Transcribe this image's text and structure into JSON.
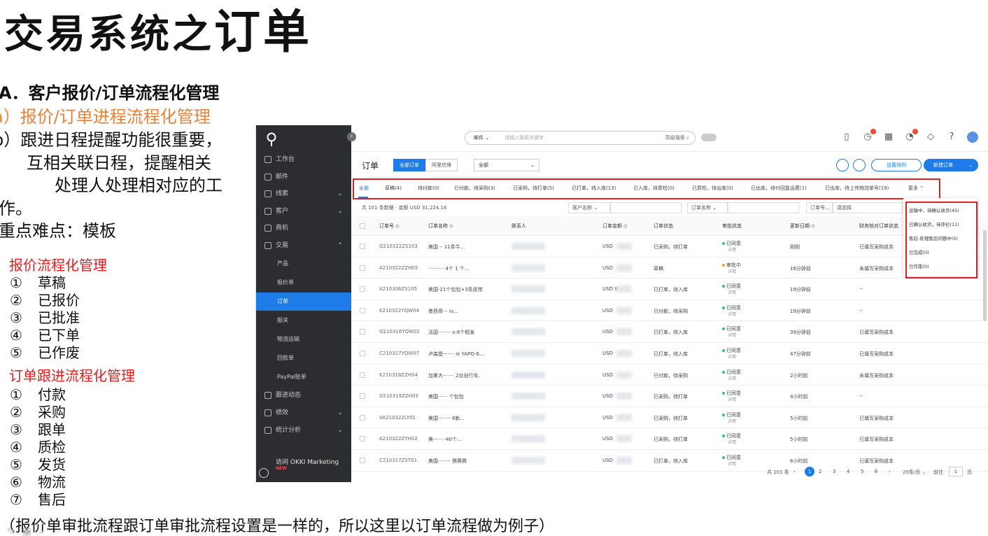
{
  "slide": {
    "title_part1": "交易系统之",
    "title_part2": "订单",
    "heading_a": "A．客户报价/订单流程化管理",
    "line_a": "a）报价/订单进程流程化管理",
    "line_b1": "b）跟进日程提醒功能很重要，",
    "line_b2": "互相关联日程，提醒相关",
    "line_b3": "处理人处理相对应的工",
    "line_b4": "作。",
    "line_key": "重点难点：模板",
    "quote_flow_title": "报价流程化管理",
    "quote_flow": [
      {
        "num": "①",
        "label": "草稿"
      },
      {
        "num": "②",
        "label": "已报价"
      },
      {
        "num": "③",
        "label": "已批准"
      },
      {
        "num": "④",
        "label": "已下单"
      },
      {
        "num": "⑤",
        "label": "已作废"
      }
    ],
    "order_flow_title": "订单跟进流程化管理",
    "order_flow": [
      {
        "num": "①",
        "label": "付款"
      },
      {
        "num": "②",
        "label": "采购"
      },
      {
        "num": "③",
        "label": "跟单"
      },
      {
        "num": "④",
        "label": "质检"
      },
      {
        "num": "⑤",
        "label": "发货"
      },
      {
        "num": "⑥",
        "label": "物流"
      },
      {
        "num": "⑦",
        "label": "售后"
      }
    ],
    "footnote": "（报价单审批流程跟订单审批流程设置是一样的，所以这里以订单流程做为例子）"
  },
  "app": {
    "sidebar": {
      "items": [
        {
          "label": "工作台",
          "icon": "home-icon"
        },
        {
          "label": "邮件",
          "icon": "mail-icon"
        },
        {
          "label": "线索",
          "icon": "lead-icon",
          "chevron": "⌄"
        },
        {
          "label": "客户",
          "icon": "customer-icon",
          "chevron": "⌄"
        },
        {
          "label": "商机",
          "icon": "opportunity-icon"
        },
        {
          "label": "交易",
          "icon": "trade-icon",
          "chevron": "⌃"
        }
      ],
      "sub_items": [
        "产品",
        "报价单",
        "订单",
        "报关",
        "物流运输",
        "回款单",
        "PayPal账单"
      ],
      "active_sub": "订单",
      "bottom_items": [
        {
          "label": "跟进动态",
          "icon": "followup-icon"
        },
        {
          "label": "绩效",
          "icon": "performance-icon",
          "chevron": "⌄"
        },
        {
          "label": "统计分析",
          "icon": "stats-icon",
          "chevron": "⌄"
        }
      ],
      "okki_label": "访问 OKKI Marketing",
      "okki_badge": "NEW"
    },
    "topbar": {
      "search_scope": "邮件",
      "search_placeholder": "请输入搜索关键字",
      "advanced_search": "高级搜索 ⌕"
    },
    "header": {
      "title": "订单",
      "segments": [
        "全部订单",
        "阿里信保"
      ],
      "active_segment": "全部订单",
      "filter_value": "全部",
      "btn_outline": "设置排列",
      "btn_primary": "新建订单"
    },
    "status_tabs": [
      "全部",
      "草稿(4)",
      "待付款(0)",
      "已付款，待采购(3)",
      "已采购，待打单(5)",
      "已打单，待入库(13)",
      "已入库，待质检(0)",
      "已质检，待出库(0)",
      "已出库，待付回复运费(1)",
      "已出库，待上传物流单号(19)",
      "更多 ⌃"
    ],
    "list_bar": {
      "count_text": "共 101 条数据 · 金额 USD 31,224.16",
      "customer_name": "客户名称",
      "order_name": "订单名称",
      "order_no_select": "订单号...",
      "search_placeholder": "请选择"
    },
    "columns": [
      "订单号 ◇",
      "订单名称 ◇",
      "联系人",
      "订单金额 ◇",
      "订单状态",
      "审批状态",
      "更新日期 ◇",
      "财务核对订单状态"
    ],
    "rows": [
      {
        "no": "O210322ZS103",
        "name": "美国··· 11条牛...",
        "contact": "",
        "amount": "USD",
        "status": "已采购，待打单",
        "approval": "已同意",
        "approval_sub": "详情",
        "approval_color": "#2ec27e",
        "updated": "刚刚",
        "finance": "已填写采购成本"
      },
      {
        "no": "A210322ZZH05",
        "name": "·········· 4个 1 个...",
        "contact": "",
        "amount": "USD",
        "status": "草稿",
        "approval": "审批中",
        "approval_sub": "详情",
        "approval_color": "#f5a623",
        "updated": "16分钟前",
        "finance": "未填写采购成本"
      },
      {
        "no": "A210306ZS105",
        "name": "美国-21个包包+3条皮带",
        "contact": "",
        "amount": "USD 8",
        "status": "已打单，待入库",
        "approval": "已同意",
        "approval_sub": "详情",
        "approval_color": "#2ec27e",
        "updated": "19分钟前",
        "finance": "--"
      },
      {
        "no": "K210322YQW04",
        "name": "墨西哥··· io...",
        "contact": "··· is",
        "amount": "USD",
        "status": "已付款，待采购",
        "approval": "已同意",
        "approval_sub": "详情",
        "approval_color": "#2ec27e",
        "updated": "19分钟前",
        "finance": "--"
      },
      {
        "no": "O210316YQW02",
        "name": "法国········ a-6个假发",
        "contact": "",
        "amount": "USD",
        "status": "已打单，待入库",
        "approval": "已同意",
        "approval_sub": "详情",
        "approval_color": "#2ec27e",
        "updated": "39分钟前",
        "finance": "已填写采购成本"
      },
      {
        "no": "C210317YQW07",
        "name": "卢森堡-······ ie YAPO-6...",
        "contact": "",
        "amount": "USD",
        "status": "已打单，待入库",
        "approval": "已同意",
        "approval_sub": "详情",
        "approval_color": "#2ec27e",
        "updated": "47分钟前",
        "finance": "已填写采购成本"
      },
      {
        "no": "K210318ZZH04",
        "name": "加拿大-······ 2台自行车,",
        "contact": "",
        "amount": "USD",
        "status": "已付款，待采购",
        "approval": "已同意",
        "approval_sub": "详情",
        "approval_color": "#2ec27e",
        "updated": "2小时前",
        "finance": "未填写采购成本"
      },
      {
        "no": "D210319ZZH03",
        "name": "美国······ 个包包",
        "contact": "",
        "amount": "USD",
        "status": "已采购，待打单",
        "approval": "已同意",
        "approval_sub": "详情",
        "approval_color": "#2ec27e",
        "updated": "4小时前",
        "finance": "--"
      },
      {
        "no": "VA210322LY01",
        "name": "美国········ 6新...",
        "contact": "--",
        "amount": "USD",
        "status": "已采购，待打单",
        "approval": "已同意",
        "approval_sub": "详情",
        "approval_color": "#2ec27e",
        "updated": "5小时前",
        "finance": "已填写采购成本"
      },
      {
        "no": "A210322ZYH02",
        "name": "美······ -40个...",
        "contact": "",
        "amount": "USD",
        "status": "已采购，待打单",
        "approval": "已同意",
        "approval_sub": "详情",
        "approval_color": "#2ec27e",
        "updated": "5小时前",
        "finance": "已填写采购成本"
      },
      {
        "no": "C210317ZST01",
        "name": "美国········ 赛赛赛",
        "contact": "",
        "amount": "USD",
        "status": "已打单，待入库",
        "approval": "已同意",
        "approval_sub": "详情",
        "approval_color": "#2ec27e",
        "updated": "6小时前",
        "finance": "已填写采购成本"
      }
    ],
    "more_menu": [
      "运输中，待确认收货(45)",
      "已确认收货，待评价(11)",
      "售后-处理售后问题中(0)",
      "已完成(0)",
      "已作废(0)"
    ],
    "pager": {
      "total": "共 101 条",
      "prev": "‹",
      "pages": [
        "1",
        "2",
        "3",
        "4",
        "5",
        "6"
      ],
      "next": "›",
      "page_size": "20条/页 ⌄",
      "goto_label": "前往",
      "goto_value": "1",
      "page_unit": "页"
    }
  }
}
